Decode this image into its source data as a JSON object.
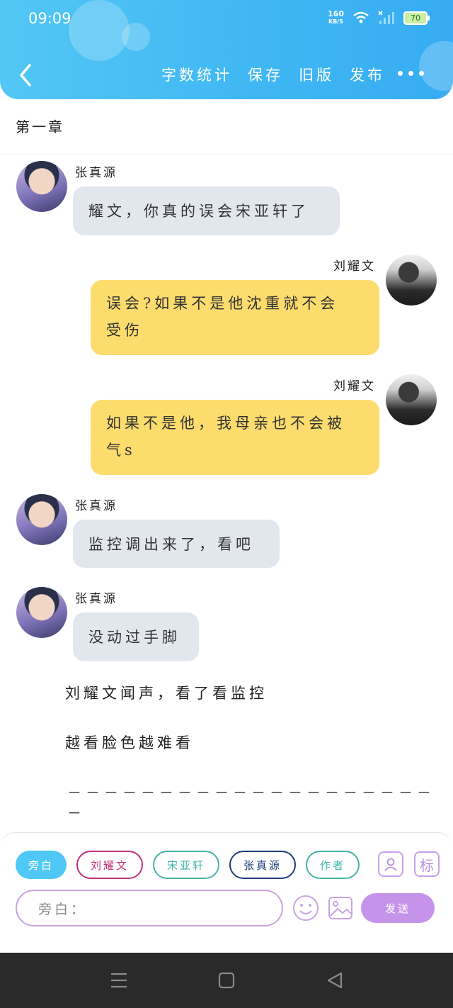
{
  "status_bar": {
    "time": "09:09",
    "net_speed_top": "160",
    "net_speed_bottom": "KB/S",
    "battery": "70"
  },
  "toolbar": {
    "word_count": "字数统计",
    "save": "保存",
    "old_version": "旧版",
    "publish": "发布"
  },
  "chapter_title": "第一章",
  "messages": [
    {
      "sender": "张真源",
      "text": "耀文，你真的误会宋亚轩了"
    },
    {
      "sender": "刘耀文",
      "line1": "误会?如果不是他沈重就不会",
      "line2": "受伤"
    },
    {
      "sender": "刘耀文",
      "line1": "如果不是他，我母亲也不会被",
      "line2": "气s"
    },
    {
      "sender": "张真源",
      "text": "监控调出来了，看吧"
    },
    {
      "sender": "张真源",
      "text": "没动过手脚"
    }
  ],
  "narration": [
    "刘耀文闻声，看了看监控",
    "越看脸色越难看"
  ],
  "separator": "－－－－－－－－－－－－－－－－－－－－－",
  "composer": {
    "roles": [
      {
        "label": "旁白",
        "color": "#4fc8f5"
      },
      {
        "label": "刘耀文",
        "color": "#c1307a"
      },
      {
        "label": "宋亚轩",
        "color": "#43b3a8"
      },
      {
        "label": "张真源",
        "color": "#1d3c7a"
      },
      {
        "label": "作者",
        "color": "#43b3a8"
      }
    ],
    "tag_icon_label": "标",
    "input_placeholder": "旁白：",
    "send_label": "发送"
  }
}
